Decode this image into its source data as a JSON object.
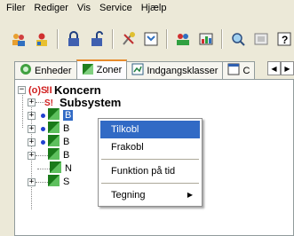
{
  "menubar": [
    "Filer",
    "Rediger",
    "Vis",
    "Service",
    "Hjælp"
  ],
  "toolbar": {
    "buttons": [
      "users-icon",
      "user-icon",
      "lock-icon",
      "unlock-icon",
      "settings-icon",
      "filter-icon",
      "group-icon",
      "report-icon",
      "search-icon",
      "window-icon",
      "help-icon"
    ]
  },
  "tabs": [
    {
      "label": "Enheder",
      "icon": "units-icon"
    },
    {
      "label": "Zoner",
      "icon": "zones-icon"
    },
    {
      "label": "Indgangsklasser",
      "icon": "access-classes-icon"
    },
    {
      "label": "C",
      "icon": "calendar-icon"
    }
  ],
  "tree": {
    "root": {
      "label": "Koncern",
      "badge": "(o)S!E"
    },
    "subsystem": {
      "label": "Subsystem"
    },
    "children": [
      "B",
      "B",
      "B",
      "B",
      "N",
      "S"
    ]
  },
  "context_menu": {
    "items": [
      "Tilkobl",
      "Frakobl",
      "Funktion på tid",
      "Tegning"
    ],
    "submenu_arrow": "▶"
  }
}
